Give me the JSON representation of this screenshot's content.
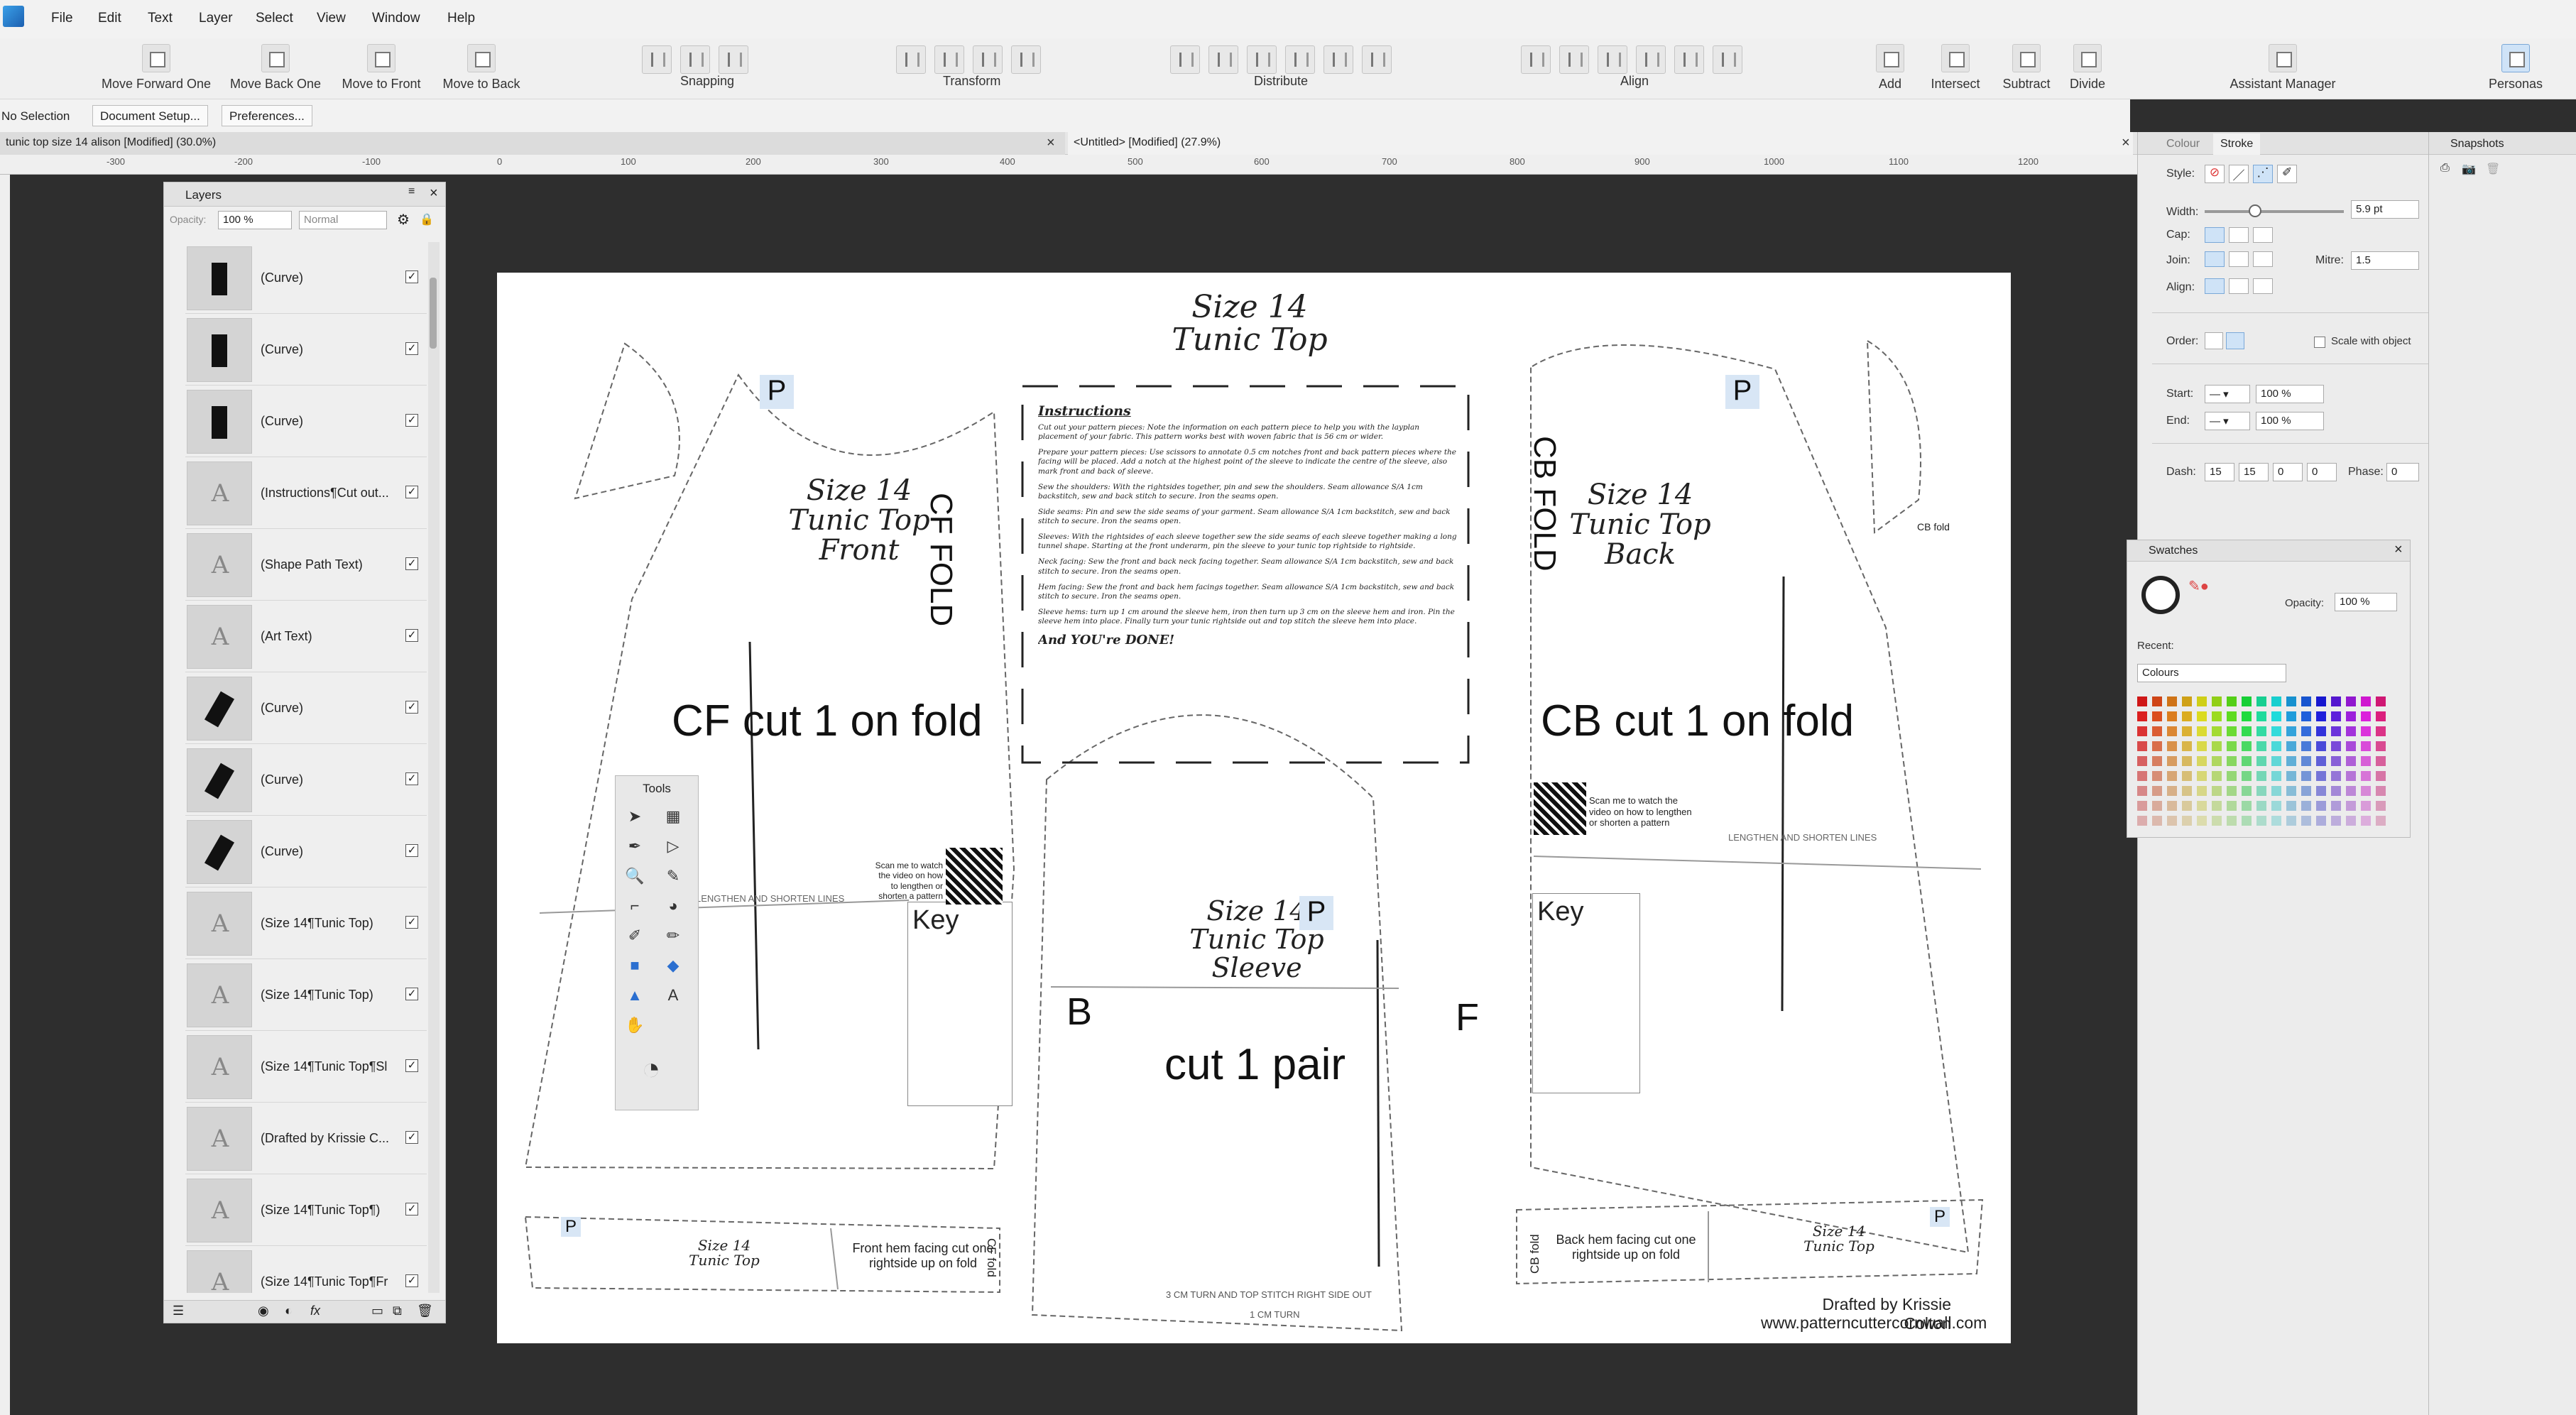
{
  "menu": [
    "File",
    "Edit",
    "Text",
    "Layer",
    "Select",
    "View",
    "Window",
    "Help"
  ],
  "toolbar": {
    "arrange": [
      "Move Forward One",
      "Move Back One",
      "Move to Front",
      "Move to Back"
    ],
    "groups": {
      "snapping": "Snapping",
      "transform": "Transform",
      "distribute": "Distribute",
      "align": "Align"
    },
    "boolean": [
      "Add",
      "Intersect",
      "Subtract",
      "Divide"
    ],
    "assistant": "Assistant Manager",
    "personas": "Personas"
  },
  "context": {
    "selection": "No Selection",
    "doc_setup": "Document Setup...",
    "prefs": "Preferences..."
  },
  "tabs": [
    {
      "title": "tunic top size 14 alison [Modified] (30.0%)"
    },
    {
      "title": "<Untitled> [Modified] (27.9%)"
    }
  ],
  "ruler": [
    "-300",
    "-200",
    "-100",
    "0",
    "100",
    "200",
    "300",
    "400",
    "500",
    "600",
    "700",
    "800",
    "900",
    "1000",
    "1100",
    "1200"
  ],
  "layers": {
    "title": "Layers",
    "opacity_label": "Opacity:",
    "opacity": "100 %",
    "blend": "Normal",
    "items": [
      {
        "name": "(Curve)",
        "icon": "curve"
      },
      {
        "name": "(Curve)",
        "icon": "curve"
      },
      {
        "name": "(Curve)",
        "icon": "curve"
      },
      {
        "name": "(Instructions¶Cut out...",
        "icon": "frame-text"
      },
      {
        "name": "(Shape Path Text)",
        "icon": "text"
      },
      {
        "name": "(Art Text)",
        "icon": "text"
      },
      {
        "name": "(Curve)",
        "icon": "curve"
      },
      {
        "name": "(Curve)",
        "icon": "curve"
      },
      {
        "name": "(Curve)",
        "icon": "curve"
      },
      {
        "name": "(Size 14¶Tunic Top)",
        "icon": "text"
      },
      {
        "name": "(Size 14¶Tunic Top)",
        "icon": "text"
      },
      {
        "name": "(Size 14¶Tunic Top¶Sl...",
        "icon": "text"
      },
      {
        "name": "(Drafted by Krissie C...",
        "icon": "text"
      },
      {
        "name": "(Size 14¶Tunic Top¶)",
        "icon": "text"
      },
      {
        "name": "(Size 14¶Tunic Top¶Fr...",
        "icon": "text"
      }
    ]
  },
  "tools_title": "Tools",
  "canvas": {
    "main_title": "Size 14\nTunic Top",
    "front_title": "Size 14\nTunic Top\nFront",
    "back_title": "Size 14\nTunic Top\nBack",
    "sleeve_title": "Size 14\nTunic Top\nSleeve",
    "cf_fold": "CF FOLD",
    "cb_fold": "CB FOLD",
    "cf_cut": "CF cut 1 on fold",
    "cb_cut": "CB cut 1 on fold",
    "cut_pair": "cut 1 pair",
    "b": "B",
    "f": "F",
    "p": "P",
    "key": "Key",
    "scan": "Scan me to watch the video on how to lengthen or shorten a pattern",
    "lengthen": "LENGTHEN AND SHORTEN LINES",
    "front_hem": "Front hem facing cut one rightside up on fold",
    "back_hem": "Back hem facing cut one rightside up on fold",
    "small_title": "Size 14\nTunic Top",
    "cf_fold_small": "CF fold",
    "cb_fold_small": "CB fold",
    "sleeve_hem": "3 CM TURN AND TOP STITCH RIGHT SIDE OUT",
    "one_cm": "1 CM TURN",
    "credit1": "Drafted by Krissie Colton",
    "credit2": "www.patterncuttercornwall.com",
    "instructions_title": "Instructions",
    "instructions": [
      "Cut out your pattern pieces: Note the information on each pattern piece to help you with the layplan placement of your fabric. This pattern works best with woven fabric that is 56 cm or wider.",
      "Prepare your pattern pieces: Use scissors to annotate 0.5 cm notches front and back pattern pieces where the facing will be placed. Add a notch at the highest point of the sleeve to indicate the centre of the sleeve, also mark front and back of sleeve.",
      "Sew the shoulders: With the rightsides together, pin and sew the shoulders. Seam allowance S/A 1cm backstitch, sew and back stitch to secure. Iron the seams open.",
      "Side seams: Pin and sew the side seams of your garment. Seam allowance S/A 1cm backstitch, sew and back stitch to secure. Iron the seams open.",
      "Sleeves: With the rightsides of each sleeve together sew the side seams of each sleeve together making a long tunnel shape. Starting at the front underarm, pin the sleeve to your tunic top rightside to rightside.",
      "Neck facing: Sew the front and back neck facing together. Seam allowance S/A 1cm backstitch, sew and back stitch to secure. Iron the seams open.",
      "Hem facing: Sew the front and back hem facings together. Seam allowance S/A 1cm backstitch, sew and back stitch to secure. Iron the seams open.",
      "Sleeve hems: turn up 1 cm around the sleeve hem, iron then turn up 3 cm on the sleeve hem and iron. Pin the sleeve hem into place. Finally turn your tunic rightside out and top stitch the sleeve hem into place."
    ],
    "done": "And YOU're DONE!"
  },
  "stroke_panel": {
    "tabs": [
      "Colour",
      "Stroke"
    ],
    "style": "Style:",
    "width_label": "Width:",
    "width": "5.9 pt",
    "cap": "Cap:",
    "join": "Join:",
    "mitre_label": "Mitre:",
    "mitre": "1.5",
    "align": "Align:",
    "order": "Order:",
    "scale_with_object": "Scale with object",
    "start": "Start:",
    "end": "End:",
    "start_pct": "100 %",
    "end_pct": "100 %",
    "dash": "Dash:",
    "dash_vals": [
      "15",
      "15",
      "0",
      "0"
    ],
    "phase_label": "Phase:",
    "phase": "0"
  },
  "snapshots": {
    "title": "Snapshots"
  },
  "swatches": {
    "title": "Swatches",
    "opacity_label": "Opacity:",
    "opacity": "100 %",
    "recent": "Recent:",
    "palette": "Colours"
  },
  "colors": {
    "accent": "#1f6fd1",
    "page": "#ffffff",
    "canvas_bg": "#2e2e2e"
  }
}
